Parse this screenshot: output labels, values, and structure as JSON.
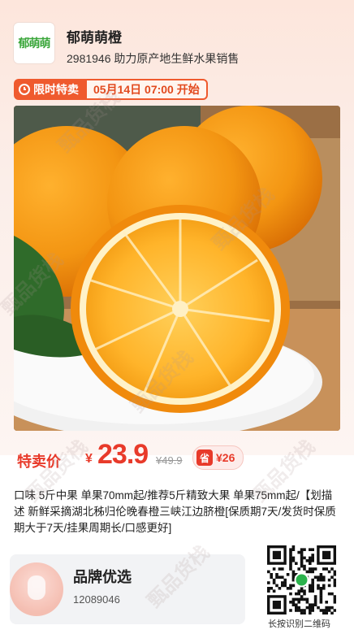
{
  "shop": {
    "logo_text": "郁萌萌",
    "name": "郁萌萌橙",
    "subtitle": "2981946 助力原产地生鲜水果销售"
  },
  "promo": {
    "tag": "限时特卖",
    "time": "05月14日 07:00 开始"
  },
  "product": {
    "image_desc": "oranges-photo"
  },
  "price": {
    "label": "特卖价",
    "currency": "¥",
    "value": "23.9",
    "original": "¥49.9",
    "save_icon": "省",
    "save_amount": "¥26"
  },
  "description": "口味 5斤中果 单果70mm起/推荐5斤精致大果 单果75mm起/【划描述 新鲜采摘湖北秭归伦晚春橙三峡江边脐橙[保质期7天/发货时保质期大于7天/挂果周期长/口感更好]",
  "brand": {
    "title": "品牌优选",
    "id": "12089046"
  },
  "qr": {
    "caption": "长按识别二维码"
  },
  "watermark": "甄品货栈",
  "colors": {
    "accent": "#e83a2a",
    "promo": "#ef5a2e",
    "logo_green": "#3aa63a"
  }
}
